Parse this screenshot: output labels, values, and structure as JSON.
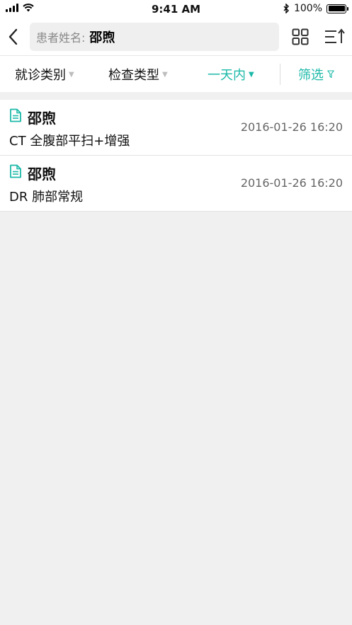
{
  "status_bar": {
    "time": "9:41 AM",
    "battery": "100%",
    "battery_level": 1.0
  },
  "search": {
    "prefix": "患者姓名:",
    "value": "邵煦"
  },
  "filters": [
    {
      "label": "就诊类别",
      "active": false
    },
    {
      "label": "检查类型",
      "active": false
    },
    {
      "label": "一天内",
      "active": true
    },
    {
      "label": "筛选",
      "active": true
    }
  ],
  "records": [
    {
      "name": "邵煦",
      "exam": "CT 全腹部平扫+增强",
      "datetime": "2016-01-26 16:20"
    },
    {
      "name": "邵煦",
      "exam": "DR 肺部常规",
      "datetime": "2016-01-26 16:20"
    }
  ],
  "colors": {
    "accent": "#1bb9a8",
    "background": "#f0f0f0"
  }
}
